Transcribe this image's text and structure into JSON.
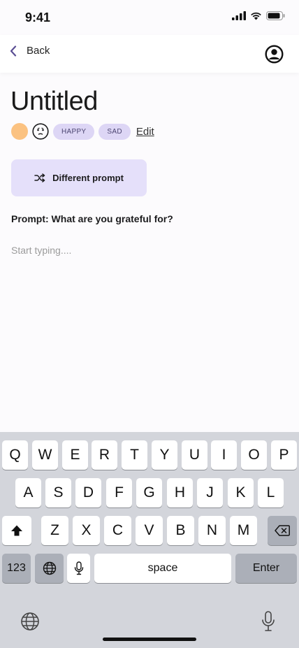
{
  "status": {
    "time": "9:41"
  },
  "nav": {
    "back_label": "Back"
  },
  "entry": {
    "title": "Untitled",
    "tags": [
      "HAPPY",
      "SAD"
    ],
    "edit_label": "Edit",
    "different_prompt_label": "Different prompt",
    "prompt": "Prompt: What are you grateful for?",
    "placeholder": "Start typing...."
  },
  "colors": {
    "accent": "#e5e0fa",
    "tag": "#ddd6f5",
    "mood": "#fbc281",
    "back_chevron": "#5b4f94"
  },
  "keyboard": {
    "row1": [
      "Q",
      "W",
      "E",
      "R",
      "T",
      "Y",
      "U",
      "I",
      "O",
      "P"
    ],
    "row2": [
      "A",
      "S",
      "D",
      "F",
      "G",
      "H",
      "J",
      "K",
      "L"
    ],
    "row3": [
      "Z",
      "X",
      "C",
      "V",
      "B",
      "N",
      "M"
    ],
    "numbers_label": "123",
    "space_label": "space",
    "enter_label": "Enter",
    "icons": [
      "shift-icon",
      "backspace-icon",
      "globe-icon",
      "microphone-icon"
    ]
  }
}
